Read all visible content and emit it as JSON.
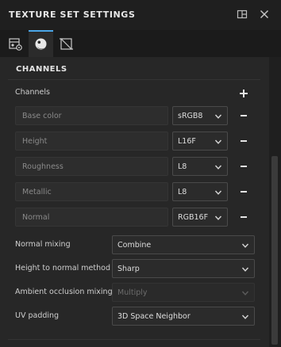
{
  "header": {
    "title": "TEXTURE SET SETTINGS"
  },
  "tabs": [
    {
      "icon": "texture-set-settings-icon",
      "active": false
    },
    {
      "icon": "material-sphere-icon",
      "active": true
    },
    {
      "icon": "mesh-geometry-icon",
      "active": false
    }
  ],
  "section": {
    "title": "CHANNELS"
  },
  "channels": {
    "label": "Channels",
    "items": [
      {
        "name": "Base color",
        "format": "sRGB8"
      },
      {
        "name": "Height",
        "format": "L16F"
      },
      {
        "name": "Roughness",
        "format": "L8"
      },
      {
        "name": "Metallic",
        "format": "L8"
      },
      {
        "name": "Normal",
        "format": "RGB16F"
      }
    ]
  },
  "properties": {
    "normal_mixing": {
      "label": "Normal mixing",
      "value": "Combine"
    },
    "height_to_normal": {
      "label": "Height to normal method",
      "value": "Sharp"
    },
    "ao_mixing": {
      "label": "Ambient occlusion mixing",
      "value": "Multiply"
    },
    "uv_padding": {
      "label": "UV padding",
      "value": "3D Space Neighbor"
    }
  }
}
